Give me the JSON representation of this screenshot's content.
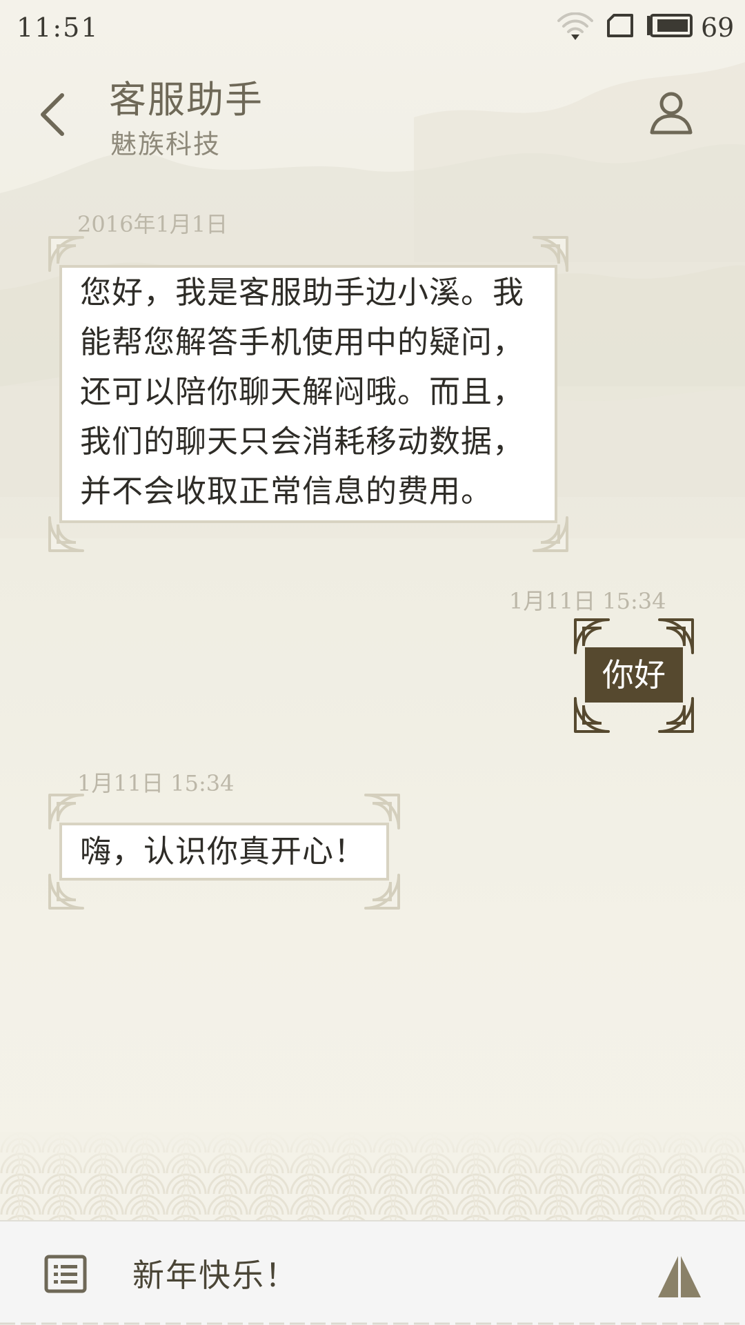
{
  "status_bar": {
    "time": "11:51",
    "battery_percent": "69",
    "icons": [
      "wifi-icon",
      "sim-card-icon",
      "battery-icon"
    ]
  },
  "header": {
    "title": "客服助手",
    "subtitle": "魅族科技",
    "back_icon": "chevron-left-icon",
    "contact_icon": "user-icon"
  },
  "messages": [
    {
      "sender": "assistant",
      "timestamp": "2016年1月1日",
      "lines": [
        "您好，我是客服助手边小溪。我",
        "能帮您解答手机使用中的疑问，",
        "还可以陪你聊天解闷哦。而且，",
        "我们的聊天只会消耗移动数据，",
        "并不会收取正常信息的费用。"
      ]
    },
    {
      "sender": "me",
      "timestamp": "1月11日 15:34",
      "lines": [
        "你好"
      ]
    },
    {
      "sender": "assistant",
      "timestamp": "1月11日 15:34",
      "lines": [
        "嗨，认识你真开心！"
      ]
    }
  ],
  "input_bar": {
    "value": "新年快乐！",
    "menu_icon": "list-icon",
    "send_icon": "send-icon"
  },
  "colors": {
    "background": "#f3f1e8",
    "accent_dark": "#56492f",
    "bubble_border": "#d8d3c2",
    "title_text": "#6e6857"
  }
}
